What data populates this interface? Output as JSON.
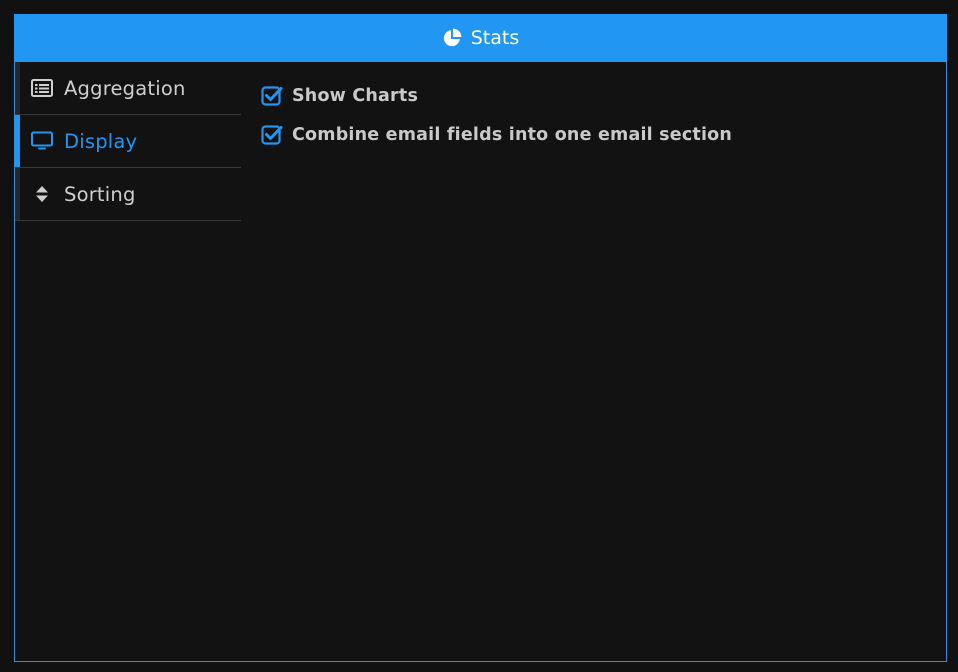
{
  "header": {
    "title": "Stats",
    "icon": "pie-chart-icon"
  },
  "sidebar": {
    "items": [
      {
        "label": "Aggregation",
        "icon": "list-alt-icon",
        "active": false
      },
      {
        "label": "Display",
        "icon": "monitor-icon",
        "active": true
      },
      {
        "label": "Sorting",
        "icon": "sort-icon",
        "active": false
      }
    ]
  },
  "display": {
    "options": [
      {
        "label": "Show Charts",
        "checked": true
      },
      {
        "label": "Combine email fields into one email section",
        "checked": true
      }
    ]
  },
  "colors": {
    "accent": "#2196f3",
    "background": "#121212",
    "text": "#cfcfcf",
    "divider": "#3a3a3a"
  }
}
